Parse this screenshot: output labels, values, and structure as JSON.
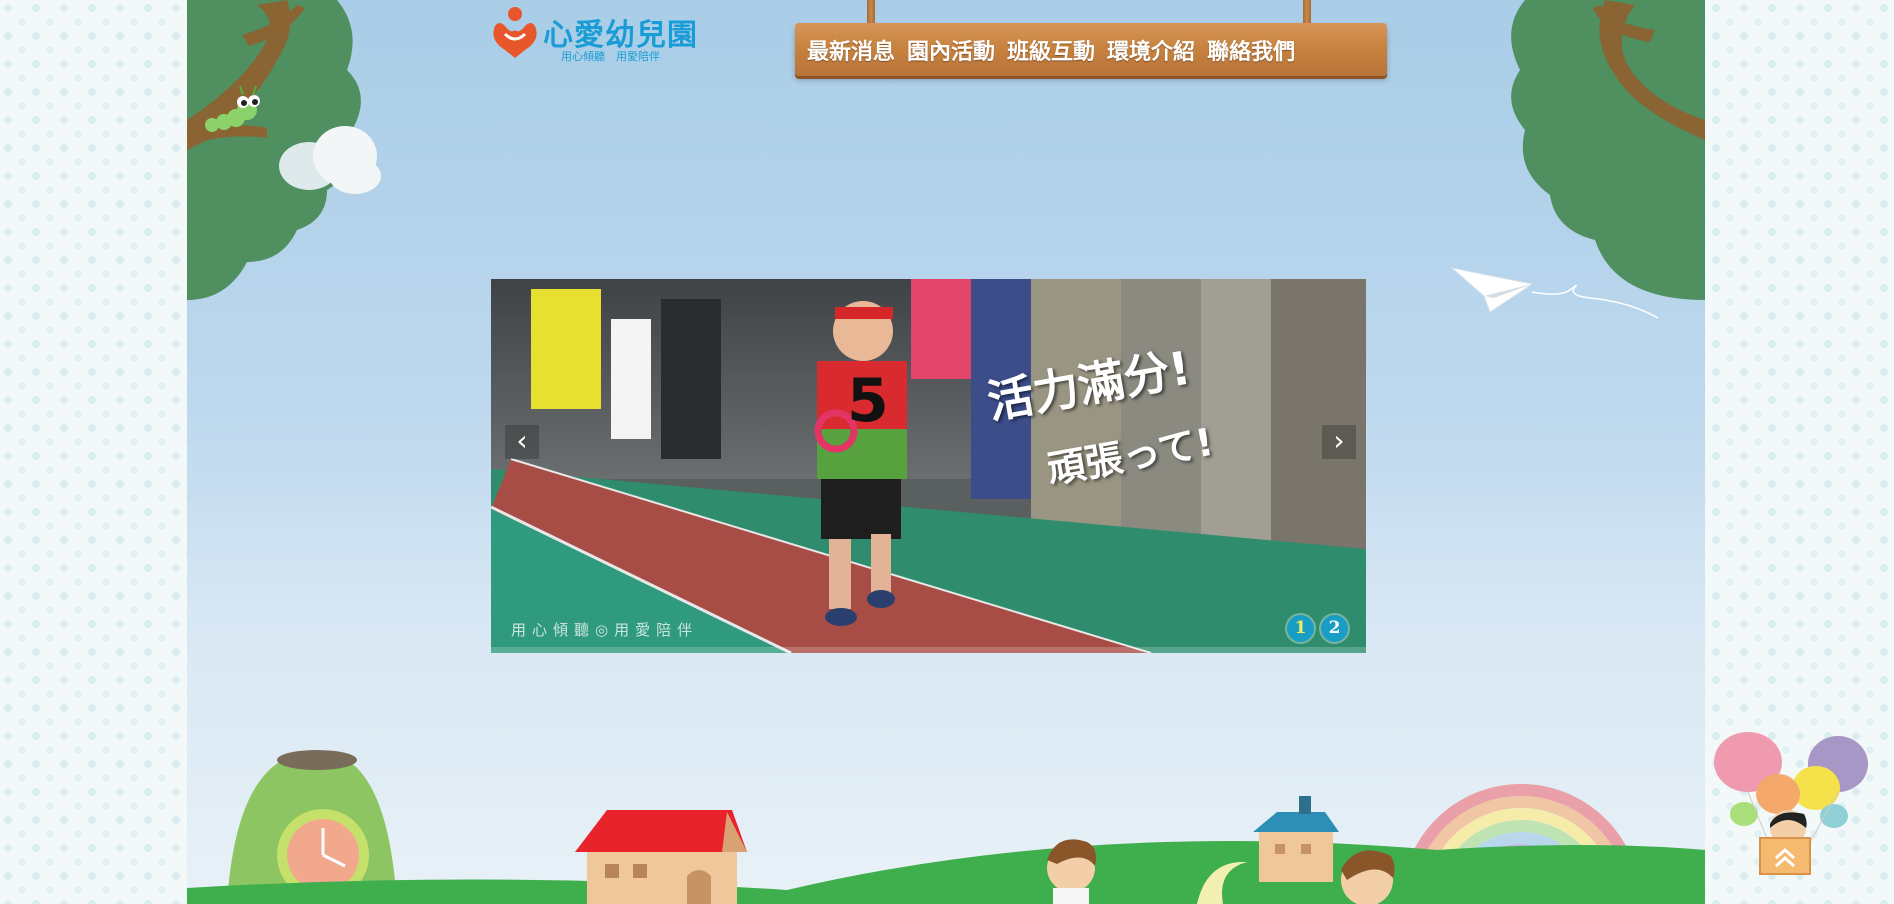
{
  "brand": {
    "name": "心愛幼兒園",
    "tagline": "用心傾聽　用愛陪伴",
    "accent": "#1a9dd6",
    "logo_icon": "heart-person-icon"
  },
  "nav": {
    "items": [
      "最新消息",
      "園內活動",
      "班級互動",
      "環境介紹",
      "聯絡我們"
    ],
    "board_color": "#c8833f"
  },
  "slider": {
    "caption_line1": "活力滿分!",
    "caption_line2": "頑張って!",
    "watermark": "用心傾聽◎用愛陪伴",
    "prev_icon": "chevron-left-icon",
    "next_icon": "chevron-right-icon",
    "prev_glyph": "‹",
    "next_glyph": "›",
    "pages": [
      "1",
      "2"
    ],
    "active_page": 1,
    "jersey_number": "5"
  },
  "scroll_top": {
    "icon": "double-chevron-up-icon"
  }
}
